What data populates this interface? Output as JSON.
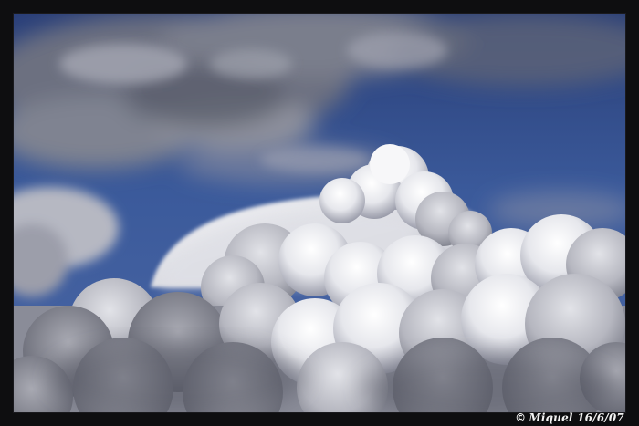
{
  "photo": {
    "subject": "sky-with-cumulonimbus-clouds",
    "colors": {
      "sky_top": "#2e4a8a",
      "sky_mid": "#3a5a9c",
      "cloud_light": "#f4f4f6",
      "cloud_shadow": "#6e7180",
      "frame": "#0e0e10"
    }
  },
  "credit": {
    "symbol": "©",
    "text": "Miquel 16/6/07"
  }
}
